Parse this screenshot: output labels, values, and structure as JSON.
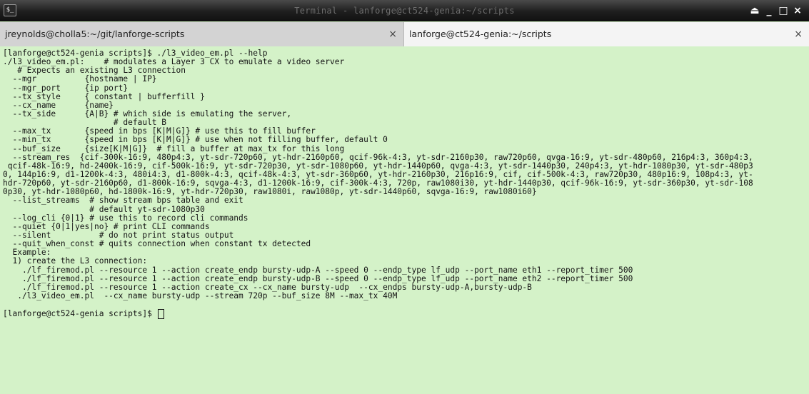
{
  "window": {
    "title": "Terminal - lanforge@ct524-genia:~/scripts",
    "app_icon_glyph": "$_",
    "controls": {
      "eject": "⏏",
      "minimize": "_",
      "maximize": "□",
      "close": "×"
    }
  },
  "tabs": [
    {
      "label": "jreynolds@cholla5:~/git/lanforge-scripts",
      "close": "×",
      "active": false
    },
    {
      "label": "lanforge@ct524-genia:~/scripts",
      "close": "×",
      "active": true
    }
  ],
  "terminal": {
    "background": "#d4f2c8",
    "lines": [
      "[lanforge@ct524-genia scripts]$ ./l3_video_em.pl --help",
      "./l3_video_em.pl:    # modulates a Layer 3 CX to emulate a video server",
      "   # Expects an existing L3 connection",
      "  --mgr          {hostname | IP}",
      "  --mgr_port     {ip port}",
      "  --tx_style     { constant | bufferfill }",
      "  --cx_name      {name}",
      "  --tx_side      {A|B} # which side is emulating the server,",
      "                       # default B",
      "  --max_tx       {speed in bps [K|M|G]} # use this to fill buffer",
      "  --min_tx       {speed in bps [K|M|G]} # use when not filling buffer, default 0",
      "  --buf_size     {size[K|M|G]}  # fill a buffer at max_tx for this long",
      "  --stream_res  {cif-300k-16:9, 480p4:3, yt-sdr-720p60, yt-hdr-2160p60, qcif-96k-4:3, yt-sdr-2160p30, raw720p60, qvga-16:9, yt-sdr-480p60, 216p4:3, 360p4:3,",
      " qcif-48k-16:9, hd-2400k-16:9, cif-500k-16:9, yt-sdr-720p30, yt-sdr-1080p60, yt-hdr-1440p60, qvga-4:3, yt-sdr-1440p30, 240p4:3, yt-hdr-1080p30, yt-sdr-480p3",
      "0, 144p16:9, d1-1200k-4:3, 480i4:3, d1-800k-4:3, qcif-48k-4:3, yt-sdr-360p60, yt-hdr-2160p30, 216p16:9, cif, cif-500k-4:3, raw720p30, 480p16:9, 108p4:3, yt-",
      "hdr-720p60, yt-sdr-2160p60, d1-800k-16:9, sqvga-4:3, d1-1200k-16:9, cif-300k-4:3, 720p, raw1080i30, yt-hdr-1440p30, qcif-96k-16:9, yt-sdr-360p30, yt-sdr-108",
      "0p30, yt-hdr-1080p60, hd-1800k-16:9, yt-hdr-720p30, raw1080i, raw1080p, yt-sdr-1440p60, sqvga-16:9, raw1080i60}",
      "  --list_streams  # show stream bps table and exit",
      "                  # default yt-sdr-1080p30",
      "  --log_cli {0|1} # use this to record cli commands",
      "  --quiet {0|1|yes|no} # print CLI commands",
      "  --silent          # do not print status output",
      "  --quit_when_const # quits connection when constant tx detected",
      "  Example:",
      "  1) create the L3 connection:",
      "    ./lf_firemod.pl --resource 1 --action create_endp bursty-udp-A --speed 0 --endp_type lf_udp --port_name eth1 --report_timer 500",
      "    ./lf_firemod.pl --resource 1 --action create_endp bursty-udp-B --speed 0 --endp_type lf_udp --port_name eth2 --report_timer 500",
      "    ./lf_firemod.pl --resource 1 --action create_cx --cx_name bursty-udp  --cx_endps bursty-udp-A,bursty-udp-B",
      "   ./l3_video_em.pl  --cx_name bursty-udp --stream 720p --buf_size 8M --max_tx 40M"
    ],
    "prompt": "[lanforge@ct524-genia scripts]$ "
  }
}
